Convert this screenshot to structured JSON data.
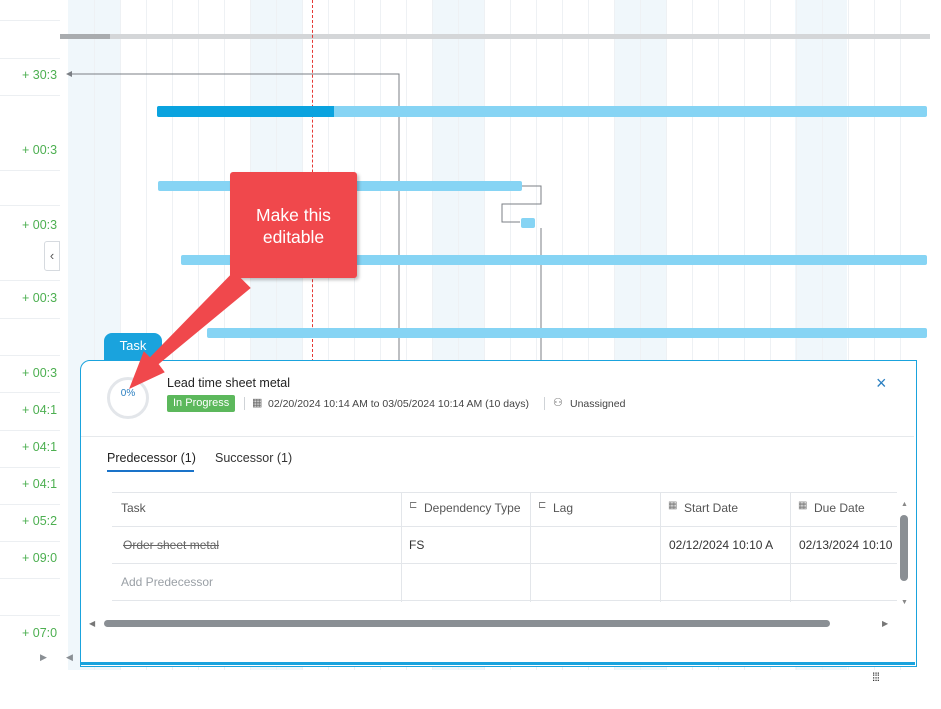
{
  "left_values": [
    "+ 30:3",
    "+ 00:3",
    "+ 00:3",
    "+ 00:3",
    "+ 00:3",
    "+ 04:1",
    "+ 04:1",
    "+ 04:1",
    "+ 05:2",
    "+ 09:0",
    "+ 07:0"
  ],
  "panel_tab": "Task",
  "task": {
    "progress": "0%",
    "name": "Lead time sheet metal",
    "status": "In Progress",
    "date_range": "02/20/2024 10:14 AM to 03/05/2024 10:14 AM (10 days)",
    "assignee": "Unassigned",
    "close_glyph": "×"
  },
  "tabs": {
    "predecessor": "Predecessor (1)",
    "successor": "Successor (1)"
  },
  "table": {
    "headers": [
      "Task",
      "Dependency Type",
      "Lag",
      "Start Date",
      "Due Date"
    ],
    "rows": [
      {
        "task": "Order sheet metal",
        "dependency_type": "FS",
        "lag": "",
        "start_date": "02/12/2024 10:10 A",
        "due_date": "02/13/2024 10:10"
      }
    ],
    "add_label": "Add Predecessor"
  },
  "annotation": {
    "line1": "Make this",
    "line2": "editable"
  },
  "colors": {
    "accent": "#1aa3dd",
    "status_green": "#5cb85c",
    "callout_red": "#f0484c",
    "bar": "#86d4f4",
    "bar_progress": "#0aa3df",
    "today_line": "#e53935"
  }
}
